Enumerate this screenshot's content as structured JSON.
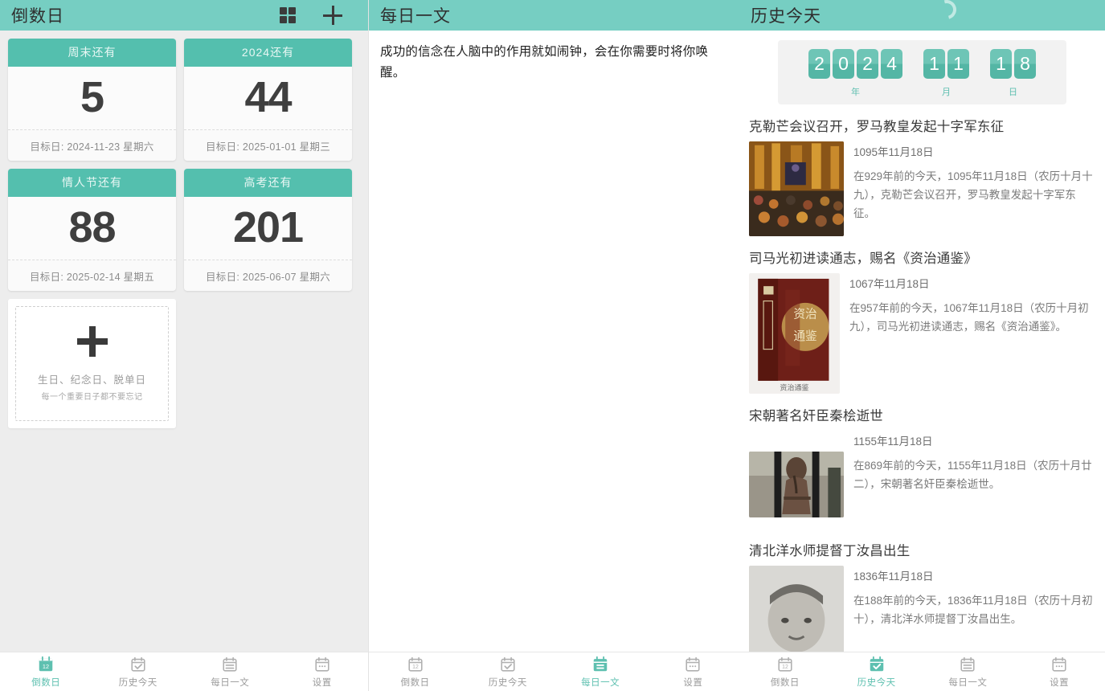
{
  "panels": [
    {
      "header": {
        "title": "倒数日",
        "grid_icon": "grid-icon",
        "plus_icon": "plus-icon"
      },
      "cards": [
        {
          "title": "周末还有",
          "days": "5",
          "target": "目标日: 2024-11-23 星期六"
        },
        {
          "title": "2024还有",
          "days": "44",
          "target": "目标日: 2025-01-01 星期三"
        },
        {
          "title": "情人节还有",
          "days": "88",
          "target": "目标日: 2025-02-14 星期五"
        },
        {
          "title": "高考还有",
          "days": "201",
          "target": "目标日: 2025-06-07 星期六"
        }
      ],
      "add_card": {
        "plus": "+",
        "line1": "生日、纪念日、脱单日",
        "line2": "每一个重要日子都不要忘记"
      },
      "tabs": [
        {
          "label": "倒数日",
          "icon": "calendar-12-icon",
          "active": true
        },
        {
          "label": "历史今天",
          "icon": "calendar-check-icon",
          "active": false
        },
        {
          "label": "每日一文",
          "icon": "calendar-lines-icon",
          "active": false
        },
        {
          "label": "设置",
          "icon": "calendar-dots-icon",
          "active": false
        }
      ]
    },
    {
      "header": {
        "title": "每日一文"
      },
      "article_text": "成功的信念在人脑中的作用就如闹钟，会在你需要时将你唤醒。",
      "tabs": [
        {
          "label": "倒数日",
          "icon": "calendar-12-icon",
          "active": false
        },
        {
          "label": "历史今天",
          "icon": "calendar-check-icon",
          "active": false
        },
        {
          "label": "每日一文",
          "icon": "calendar-lines-icon",
          "active": true
        },
        {
          "label": "设置",
          "icon": "calendar-dots-icon",
          "active": false
        }
      ]
    },
    {
      "header": {
        "title": "历史今天",
        "spinner": "loading-spinner-icon"
      },
      "flip_date": {
        "year_digits": [
          "2",
          "0",
          "2",
          "4"
        ],
        "month_digits": [
          "1",
          "1"
        ],
        "day_digits": [
          "1",
          "8"
        ],
        "year_label": "年",
        "month_label": "月",
        "day_label": "日"
      },
      "events": [
        {
          "title": "克勒芒会议召开，罗马教皇发起十字军东征",
          "date": "1095年11月18日",
          "desc": "在929年前的今天，1095年11月18日（农历十月十九），克勒芒会议召开，罗马教皇发起十字军东征。",
          "thumb": "medieval-assembly-painting"
        },
        {
          "title": "司马光初进读通志，赐名《资治通鉴》",
          "date": "1067年11月18日",
          "desc": "在957年前的今天，1067年11月18日（农历十月初九），司马光初进读通志，赐名《资治通鉴》。",
          "thumb": "book-box-set-photo"
        },
        {
          "title": "宋朝著名奸臣秦桧逝世",
          "date": "1155年11月18日",
          "desc": "在869年前的今天，1155年11月18日（农历十月廿二），宋朝著名奸臣秦桧逝世。",
          "thumb": "kneeling-statue-photo"
        },
        {
          "title": "清北洋水师提督丁汝昌出生",
          "date": "1836年11月18日",
          "desc": "在188年前的今天，1836年11月18日（农历十月初十），清北洋水师提督丁汝昌出生。",
          "thumb": "portrait-photo"
        }
      ],
      "tabs": [
        {
          "label": "倒数日",
          "icon": "calendar-12-icon",
          "active": false
        },
        {
          "label": "历史今天",
          "icon": "calendar-check-icon",
          "active": true
        },
        {
          "label": "每日一文",
          "icon": "calendar-lines-icon",
          "active": false
        },
        {
          "label": "设置",
          "icon": "calendar-dots-icon",
          "active": false
        }
      ]
    }
  ],
  "colors": {
    "header_teal": "#76cec2",
    "card_header_teal": "#54bfae",
    "accent_teal": "#5ec0b0",
    "panel_gray": "#ededed",
    "text_dark": "#3a3a3a",
    "text_muted": "#9c9c9c"
  }
}
